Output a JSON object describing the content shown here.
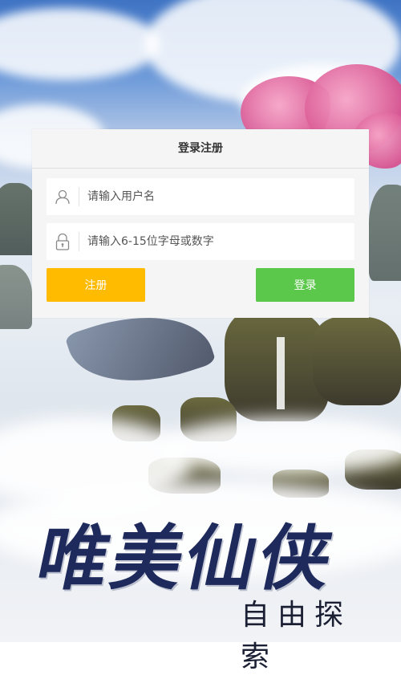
{
  "colors": {
    "register_button": "#ffbb00",
    "login_button": "#5cc84b",
    "panel_background": "#f5f5f5",
    "title_text": "#333333"
  },
  "login_panel": {
    "title": "登录注册",
    "username": {
      "icon": "user-icon",
      "placeholder": "请输入用户名",
      "value": ""
    },
    "password": {
      "icon": "lock-icon",
      "placeholder": "请输入6-15位字母或数字",
      "value": ""
    },
    "register_label": "注册",
    "login_label": "登录"
  },
  "brand": {
    "main": "唯美仙侠",
    "sub": "自由探索"
  }
}
